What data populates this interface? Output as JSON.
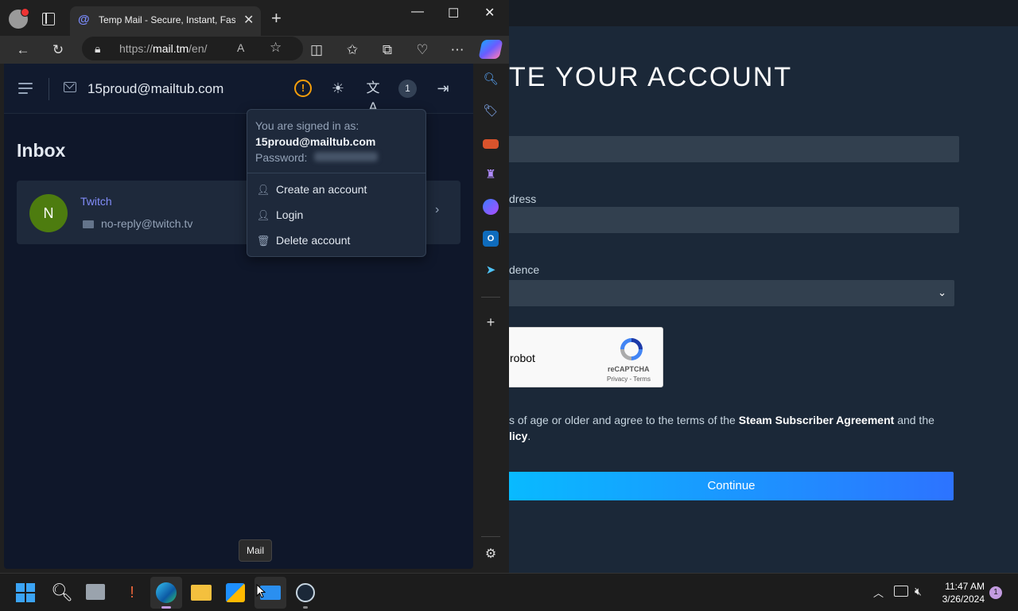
{
  "browser": {
    "tab_title": "Temp Mail - Secure, Instant, Fast",
    "url_prefix": "https://",
    "url_domain": "mail.tm",
    "url_path": "/en/"
  },
  "app": {
    "email": "15proud@mailtub.com",
    "notification_count": "1",
    "inbox_title": "Inbox",
    "messages": [
      {
        "avatar_letter": "N",
        "sender": "Twitch",
        "from": "no-reply@twitch.tv"
      }
    ]
  },
  "account_menu": {
    "signed_in_label": "You are signed in as:",
    "signed_in_email": "15proud@mailtub.com",
    "password_label": "Password:",
    "items": [
      {
        "label": "Create an account",
        "icon": "user-plus-icon"
      },
      {
        "label": "Login",
        "icon": "user-icon"
      },
      {
        "label": "Delete account",
        "icon": "trash-icon"
      }
    ]
  },
  "tooltip": "Mail",
  "steam": {
    "title": "TE YOUR ACCOUNT",
    "email_label_fragment": "dress",
    "residence_label_fragment": "dence",
    "captcha_text": "robot",
    "captcha_brand": "reCAPTCHA",
    "captcha_terms": "Privacy - Terms",
    "agree_pre": "s of age or older and agree to the terms of the",
    "agree_link": "Steam Subscriber Agreement",
    "agree_post": "and the",
    "agree_line2": "licy",
    "agree_line2_end": ".",
    "continue_label": "Continue"
  },
  "taskbar": {
    "time": "11:47 AM",
    "date": "3/26/2024",
    "notification_count": "1"
  },
  "colors": {
    "accent_indigo": "#818cf8",
    "warning": "#f59e0b",
    "avatar_green": "#4d7c0f",
    "steam_bg": "#1b2838",
    "continue_start": "#06bfff",
    "continue_end": "#2d73ff"
  }
}
